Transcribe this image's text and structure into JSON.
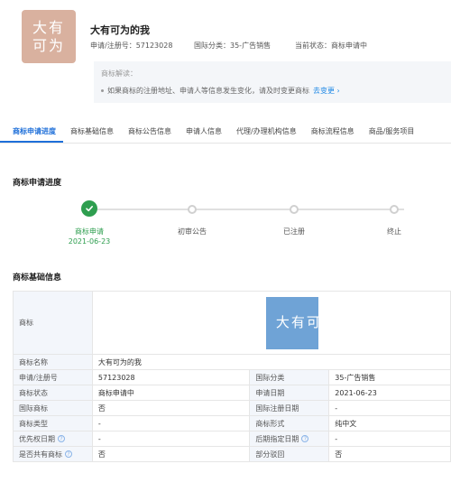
{
  "header": {
    "logo_text": "大有可为",
    "logo_color": "#d9b19f",
    "trademark_name": "大有可为的我",
    "reg_no": "申请/注册号：57123028",
    "intl_class": "国际分类：35-广告销售",
    "status": "当前状态：商标申请中",
    "notice_title": "商标解读：",
    "notice_text": "如果商标的注册地址、申请人等信息发生变化，请及时变更商标",
    "notice_link": "去变更"
  },
  "tabs": [
    {
      "label": "商标申请进度",
      "active": true
    },
    {
      "label": "商标基础信息",
      "active": false
    },
    {
      "label": "商标公告信息",
      "active": false
    },
    {
      "label": "申请人信息",
      "active": false
    },
    {
      "label": "代理/办理机构信息",
      "active": false
    },
    {
      "label": "商标流程信息",
      "active": false
    },
    {
      "label": "商品/服务项目",
      "active": false
    }
  ],
  "progress": {
    "title": "商标申请进度",
    "steps": [
      {
        "label": "商标申请",
        "date": "2021-06-23",
        "done": true
      },
      {
        "label": "初审公告",
        "date": "",
        "done": false
      },
      {
        "label": "已注册",
        "date": "",
        "done": false
      },
      {
        "label": "终止",
        "date": "",
        "done": false
      }
    ],
    "done_color": "#2e9e4f"
  },
  "basic_info": {
    "title": "商标基础信息",
    "trademark_label": "商标",
    "trademark_image_text": "大有可为",
    "image_color": "#6fa3d6",
    "name_label": "商标名称",
    "name_value": "大有可为的我",
    "rows": [
      {
        "l1": "申请/注册号",
        "v1": "57123028",
        "l2": "国际分类",
        "v2": "35-广告销售",
        "q1": false,
        "q2": false
      },
      {
        "l1": "商标状态",
        "v1": "商标申请中",
        "l2": "申请日期",
        "v2": "2021-06-23",
        "q1": false,
        "q2": false
      },
      {
        "l1": "国际商标",
        "v1": "否",
        "l2": "国际注册日期",
        "v2": "-",
        "q1": false,
        "q2": false
      },
      {
        "l1": "商标类型",
        "v1": "-",
        "l2": "商标形式",
        "v2": "纯中文",
        "q1": false,
        "q2": false
      },
      {
        "l1": "优先权日期",
        "v1": "-",
        "l2": "后期指定日期",
        "v2": "-",
        "q1": true,
        "q2": true
      },
      {
        "l1": "是否共有商标",
        "v1": "否",
        "l2": "部分驳回",
        "v2": "否",
        "q1": true,
        "q2": false
      }
    ]
  }
}
